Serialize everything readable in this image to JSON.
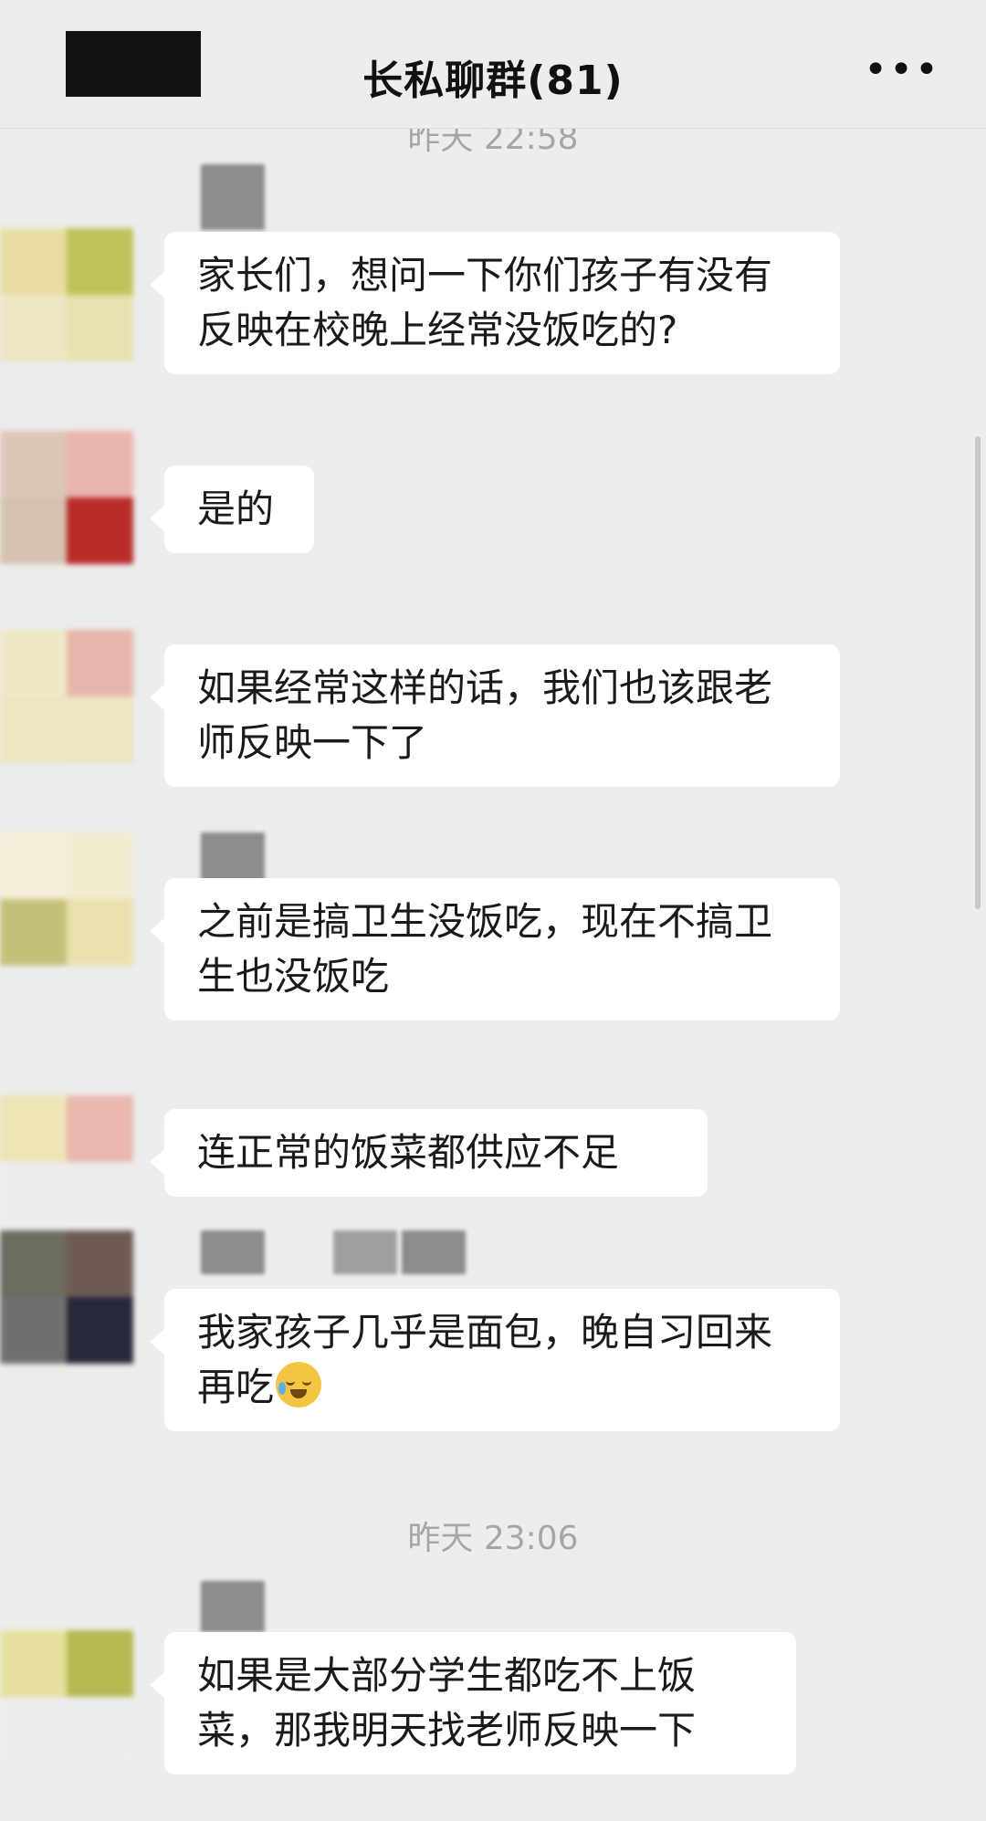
{
  "header": {
    "title": "长私聊群(81)",
    "more_icon": "more-dots-icon"
  },
  "timestamps": {
    "t1": "昨天 22:58",
    "t2": "昨天 23:06"
  },
  "messages": [
    {
      "text": "家长们，想问一下你们孩子有没有反映在校晚上经常没饭吃的?"
    },
    {
      "text": "是的"
    },
    {
      "text": "如果经常这样的话，我们也该跟老师反映一下了"
    },
    {
      "text": "之前是搞卫生没饭吃，现在不搞卫生也没饭吃"
    },
    {
      "text": "连正常的饭菜都供应不足"
    },
    {
      "text": "我家孩子几乎是面包，晚自习回来再吃",
      "emoji": "crying-laughing-emoji"
    },
    {
      "text": "如果是大部分学生都吃不上饭菜，那我明天找老师反映一下"
    }
  ],
  "colors": {
    "background": "#ededed",
    "bubble": "#ffffff",
    "timestamp": "#a6a6a6",
    "redaction": "#111111"
  }
}
